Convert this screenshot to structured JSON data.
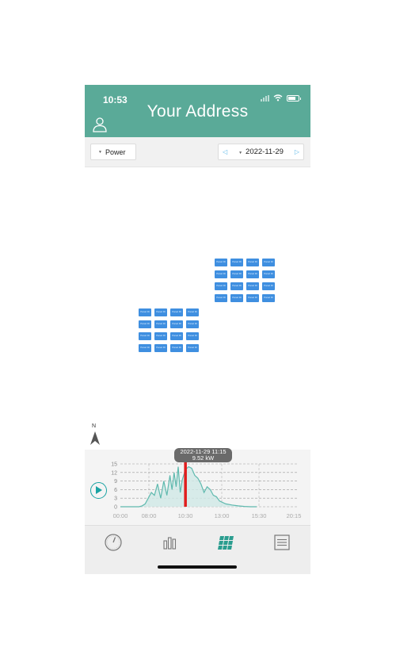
{
  "status": {
    "time": "10:53"
  },
  "header": {
    "title": "Your Address"
  },
  "toolbar": {
    "metric": "Power",
    "date": "2022-11-29"
  },
  "map": {
    "compass_label": "N",
    "panel_label": "Panel ID",
    "panel_color": "#3f8fe0",
    "arrays": [
      {
        "rows": 4,
        "cols": 4
      },
      {
        "rows": 4,
        "cols": 4
      }
    ]
  },
  "chart_data": {
    "type": "area",
    "x": [
      "06:00",
      "06:30",
      "07:00",
      "07:30",
      "07:45",
      "08:00",
      "08:15",
      "08:30",
      "08:45",
      "09:00",
      "09:15",
      "09:30",
      "09:45",
      "10:00",
      "10:10",
      "10:20",
      "10:30",
      "10:40",
      "10:50",
      "11:00",
      "11:15",
      "11:30",
      "11:45",
      "12:00",
      "12:15",
      "12:30",
      "12:45",
      "13:00",
      "13:15",
      "13:30",
      "13:45",
      "14:00",
      "14:30",
      "15:00",
      "15:30",
      "16:00",
      "16:30",
      "17:00"
    ],
    "series": [
      {
        "values": [
          0,
          0,
          0,
          0,
          0.3,
          1,
          3,
          5,
          4,
          8,
          3,
          9,
          4,
          11,
          6,
          12,
          7,
          14,
          5,
          9.5,
          13,
          14,
          13.5,
          11,
          10,
          8,
          5,
          7,
          6,
          4,
          3.5,
          2,
          1,
          0.6,
          0.3,
          0.1,
          0,
          0
        ]
      }
    ],
    "xticks": [
      "00:00",
      "08:00",
      "10:30",
      "13:00",
      "15:30",
      "20:15"
    ],
    "yticks": [
      0,
      3,
      6,
      9,
      12,
      15
    ],
    "ylim": [
      0,
      15
    ],
    "grid": true,
    "highlight": {
      "label_time": "2022-11-29 11:15",
      "label_value": "9.52 kW",
      "x": "11:15",
      "y": 9.52,
      "color": "#e11d1d"
    },
    "line_color": "#5fb9ae",
    "fill_color": "#cfe9e6"
  },
  "tabs": [
    {
      "name": "gauge-icon",
      "active": false
    },
    {
      "name": "bar-chart-icon",
      "active": false
    },
    {
      "name": "panel-layout-icon",
      "active": true
    },
    {
      "name": "list-icon",
      "active": false
    }
  ],
  "colors": {
    "accent": "#5aaa98",
    "active_tab": "#2a9d8f",
    "inactive_tab": "#777777"
  }
}
